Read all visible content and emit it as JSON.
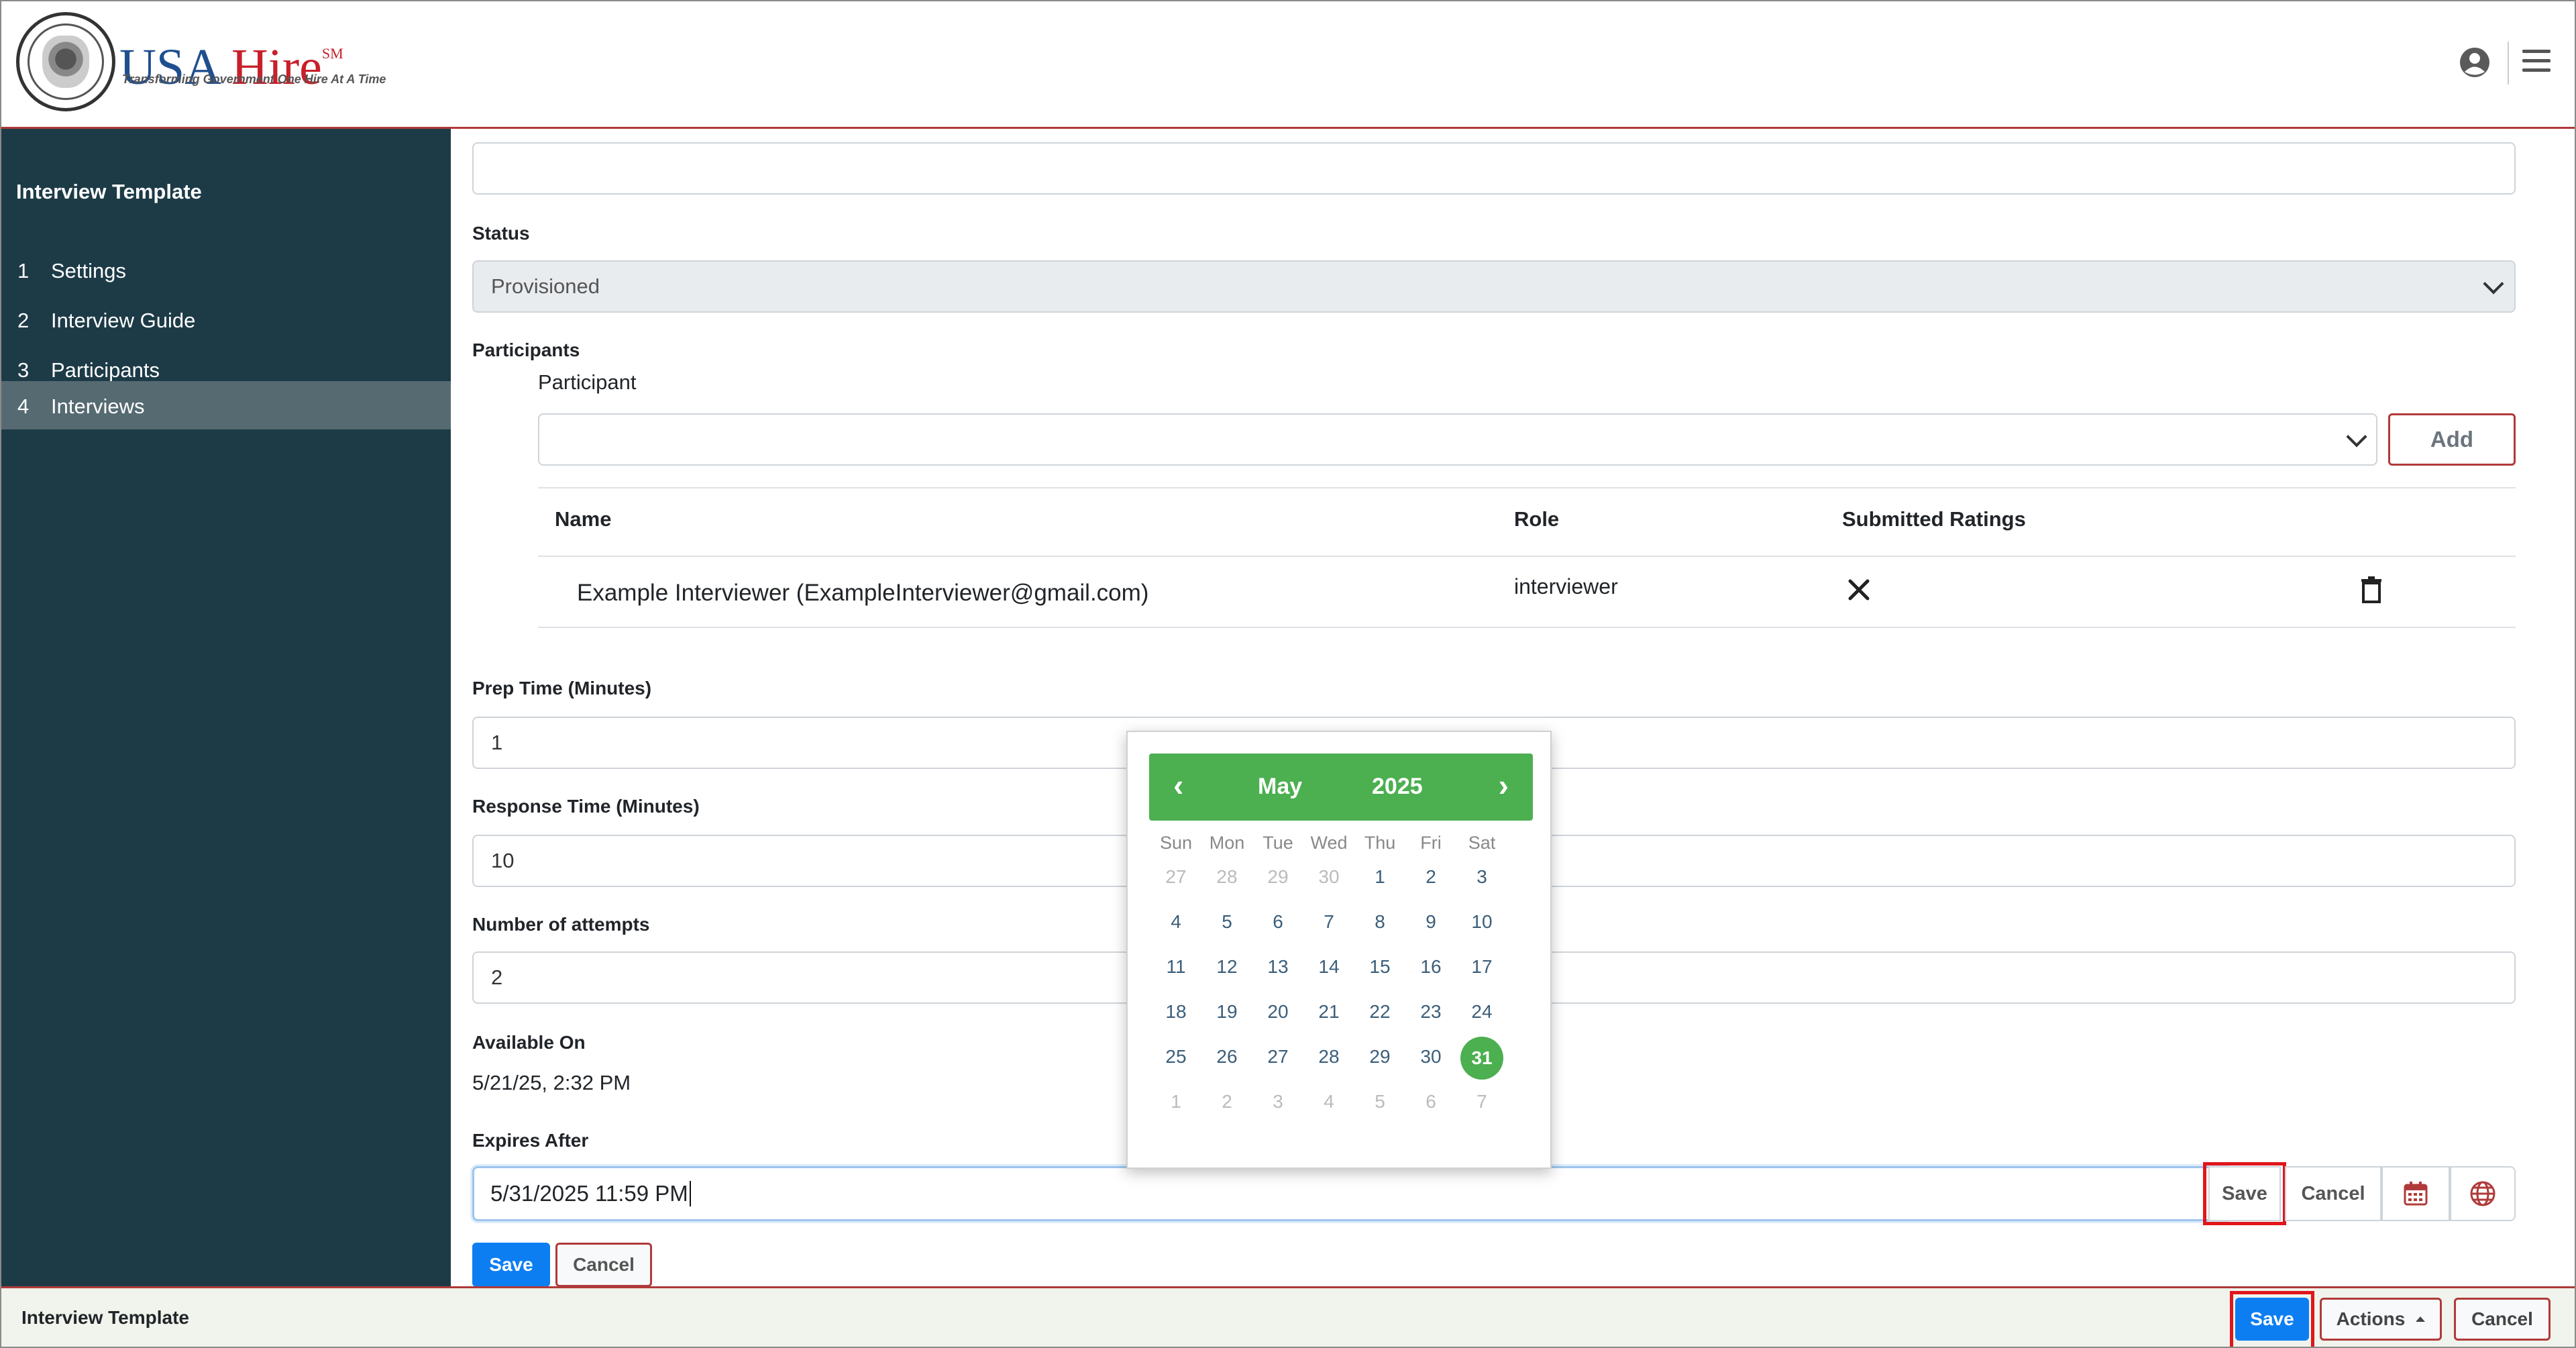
{
  "header": {
    "brand_usa": "USA",
    "brand_hire": "Hire",
    "brand_sm": "SM",
    "tagline": "Transforming Government One Hire At A Time",
    "icons": [
      "user-circle-icon",
      "hamburger-menu-icon"
    ]
  },
  "sidebar": {
    "title": "Interview Template",
    "items": [
      {
        "num": "1",
        "label": "Settings"
      },
      {
        "num": "2",
        "label": "Interview Guide"
      },
      {
        "num": "3",
        "label": "Participants"
      },
      {
        "num": "4",
        "label": "Interviews"
      }
    ]
  },
  "form": {
    "status_label": "Status",
    "status_value": "Provisioned",
    "participants_label": "Participants",
    "participant_sublabel": "Participant",
    "add_label": "Add",
    "table_headers": [
      "Name",
      "Role",
      "Submitted Ratings"
    ],
    "rows": [
      {
        "name": "Example Interviewer (ExampleInterviewer@gmail.com)",
        "role": "interviewer",
        "ratings_icon": "x-icon",
        "delete_icon": "trash-icon"
      }
    ],
    "prep_label": "Prep Time (Minutes)",
    "prep_value": "1",
    "response_label": "Response Time (Minutes)",
    "response_value": "10",
    "attempts_label": "Number of attempts",
    "attempts_value": "2",
    "available_label": "Available On",
    "available_value": "5/21/25, 2:32 PM",
    "expires_label": "Expires After",
    "expires_value": "5/31/2025 11:59 PM",
    "expires_save": "Save",
    "expires_cancel": "Cancel",
    "save_label": "Save",
    "cancel_label": "Cancel"
  },
  "calendar": {
    "month": "May",
    "year": "2025",
    "prev": "‹",
    "next": "›",
    "dow": [
      "Sun",
      "Mon",
      "Tue",
      "Wed",
      "Thu",
      "Fri",
      "Sat"
    ],
    "weeks": [
      [
        "27",
        "28",
        "29",
        "30",
        "1",
        "2",
        "3"
      ],
      [
        "4",
        "5",
        "6",
        "7",
        "8",
        "9",
        "10"
      ],
      [
        "11",
        "12",
        "13",
        "14",
        "15",
        "16",
        "17"
      ],
      [
        "18",
        "19",
        "20",
        "21",
        "22",
        "23",
        "24"
      ],
      [
        "25",
        "26",
        "27",
        "28",
        "29",
        "30",
        "31"
      ],
      [
        "1",
        "2",
        "3",
        "4",
        "5",
        "6",
        "7"
      ]
    ],
    "selected": "31",
    "accent": "#4caf50"
  },
  "footer": {
    "title": "Interview Template",
    "save_label": "Save",
    "actions_label": "Actions",
    "cancel_label": "Cancel"
  },
  "colors": {
    "sidebar_bg": "#1d3b47",
    "active_item": "#566a72",
    "primary": "#0d7ef2",
    "highlight": "#e0161b"
  }
}
